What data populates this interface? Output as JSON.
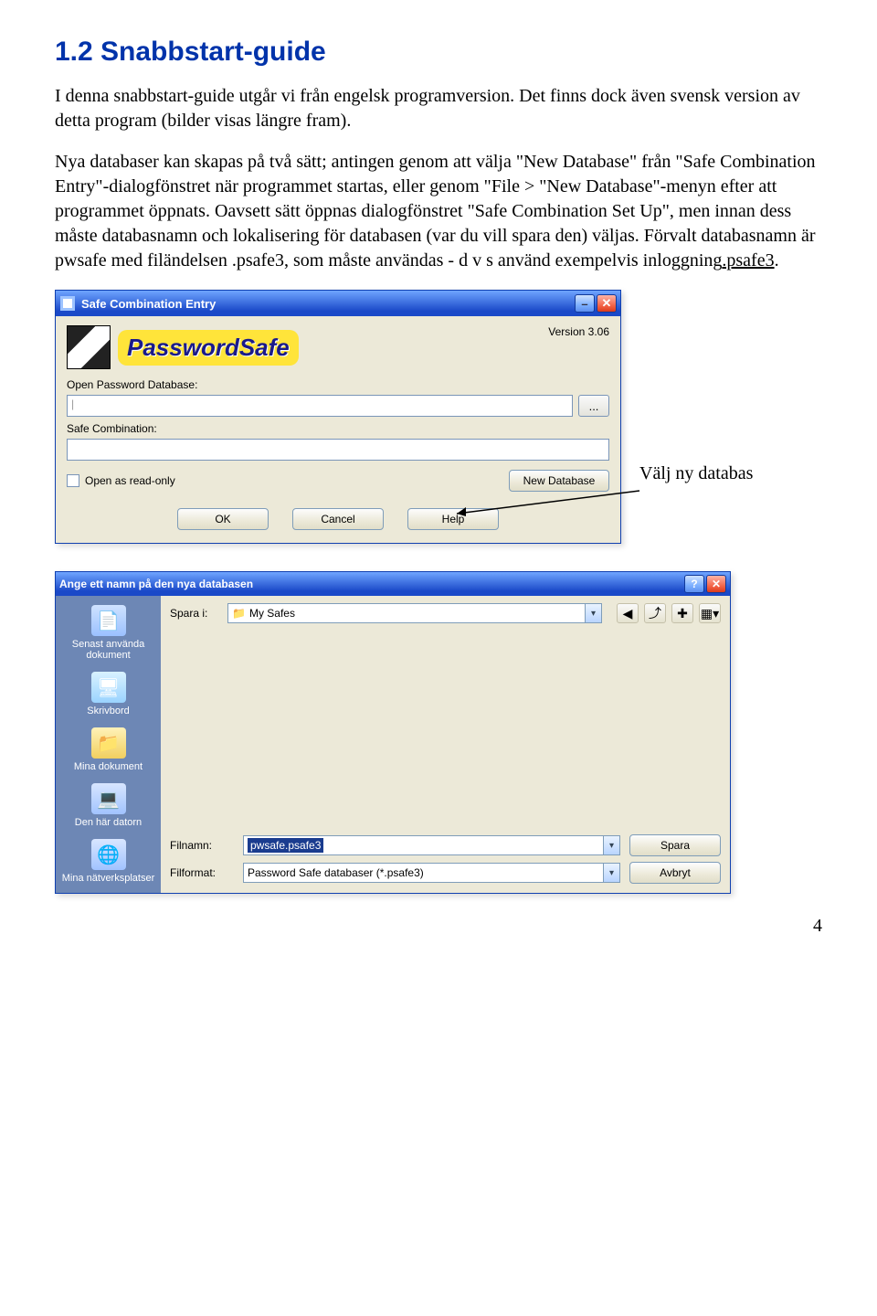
{
  "heading": "1.2 Snabbstart-guide",
  "para1": "I denna snabbstart-guide utgår vi från engelsk programversion. Det finns dock även svensk version av detta program (bilder visas längre fram).",
  "para2_a": "Nya databaser kan skapas på två sätt; antingen genom att välja \"New Database\" från \"Safe Combination Entry\"-dialogfönstret när programmet startas, eller genom \"File > \"New Database\"-menyn efter att programmet öppnats. Oavsett sätt öppnas dialogfönstret \"Safe Combination Set Up\", men innan dess måste databasnamn och lokalisering för databasen (var du vill spara den) väljas. Förvalt databasnamn är pwsafe med filändelsen .psafe3, som måste användas - d v s använd exempelvis inloggning",
  "para2_b": ".psafe3",
  "para2_c": ".",
  "annotation": "Välj ny databas",
  "dlg1": {
    "title": "Safe Combination Entry",
    "brand": "PasswordSafe",
    "version": "Version 3.06",
    "label_open": "Open Password Database:",
    "browse": "...",
    "label_combo": "Safe Combination:",
    "readonly": "Open as read-only",
    "btn_new": "New Database",
    "btn_ok": "OK",
    "btn_cancel": "Cancel",
    "btn_help": "Help"
  },
  "dlg2": {
    "title": "Ange ett namn på den nya databasen",
    "savein_label": "Spara i:",
    "savein_value": "My Safes",
    "places": {
      "recent": "Senast använda dokument",
      "desktop": "Skrivbord",
      "mydocs": "Mina dokument",
      "mycomputer": "Den här datorn",
      "network": "Mina nätverksplatser"
    },
    "filename_label": "Filnamn:",
    "filename_value": "pwsafe.psafe3",
    "filetype_label": "Filformat:",
    "filetype_value": "Password Safe databaser (*.psafe3)",
    "btn_save": "Spara",
    "btn_cancel": "Avbryt"
  },
  "pagenum": "4"
}
